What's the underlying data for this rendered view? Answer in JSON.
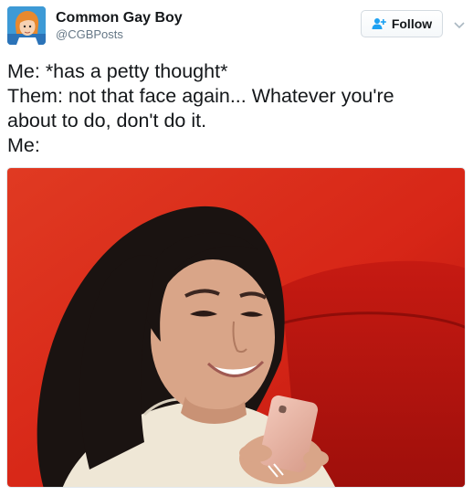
{
  "user": {
    "display_name": "Common Gay Boy",
    "handle": "@CGBPosts"
  },
  "follow_button": {
    "label": "Follow"
  },
  "tweet": {
    "lines": [
      "Me: *has a petty thought*",
      "Them: not that face again... Whatever you're",
      "about to do, don't do it.",
      "Me:"
    ]
  },
  "icons": {
    "follow": "add-user-icon",
    "menu": "chevron-down-icon"
  },
  "colors": {
    "accent": "#1da1f2",
    "text": "#14171a",
    "secondary_text": "#657786",
    "media_background": "#d9261c"
  }
}
